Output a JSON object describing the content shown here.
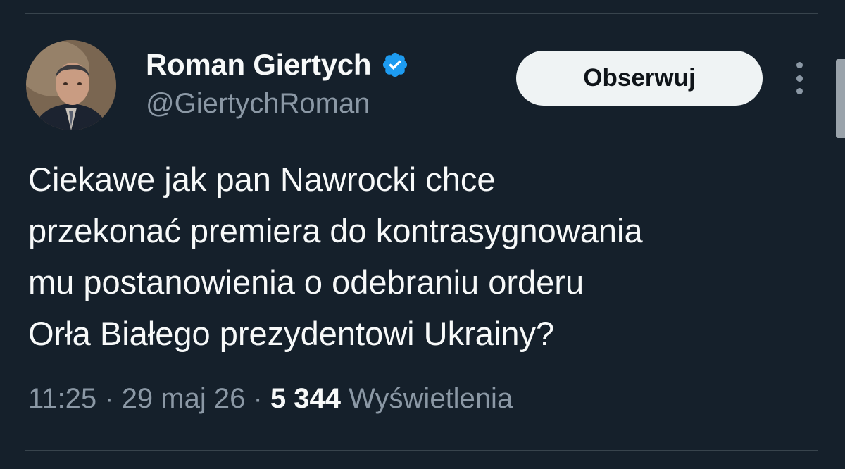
{
  "author": {
    "display_name": "Roman Giertych",
    "handle": "@GiertychRoman",
    "verified": true
  },
  "follow_button": {
    "label": "Obserwuj"
  },
  "tweet": {
    "lines": [
      "Ciekawe jak pan Nawrocki chce",
      "przekonać premiera do kontrasygnowania",
      "mu postanowienia o odebraniu orderu",
      "Orła Białego prezydentowi Ukrainy?"
    ]
  },
  "meta": {
    "time": "11:25",
    "separator": " · ",
    "date": "29 maj 26",
    "views_count": "5 344",
    "views_label": "Wyświetlenia"
  },
  "colors": {
    "background": "#15202b",
    "primary_text": "#f7f9f9",
    "secondary_text": "#8b98a5",
    "verified_badge": "#1d9bf0",
    "button_bg": "#eff3f4"
  },
  "icons": {
    "verified": "verified-badge-icon",
    "more": "more-options-icon"
  }
}
